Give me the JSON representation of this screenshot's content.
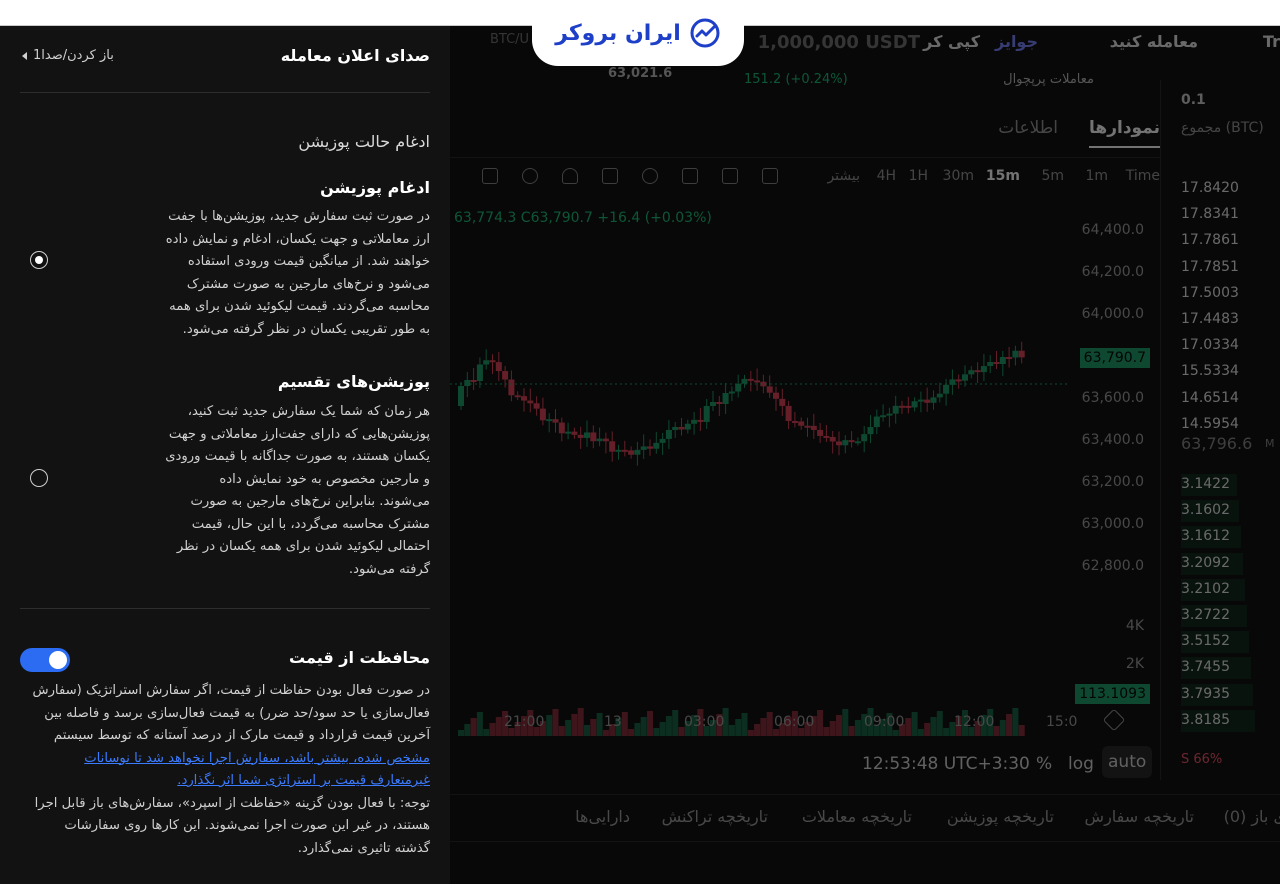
{
  "brand": {
    "logo_text": "ایران بروکر",
    "accent": "#1e3fc8"
  },
  "panel": {
    "title": "صدای اعلان معامله",
    "back_label": "باز کردن/صدا1",
    "section_heading": "ادغام حالت پوزیشن",
    "option_merge": {
      "title": "ادغام پوزیشن",
      "lines": [
        "در صورت ثبت سفارش جدید، پوزیشن‌ها با جفت",
        "ارز معاملاتی و جهت یکسان، ادغام و نمایش داده",
        "خواهند شد. از میانگین قیمت ورودی استفاده",
        "می‌شود و نرخ‌های مارجین به صورت مشترک",
        "محاسبه می‌گردند. قیمت لیکوئید شدن برای همه",
        "به طور تقریبی یکسان در نظر گرفته می‌شود."
      ],
      "selected": true
    },
    "option_split": {
      "title": "پوزیشن‌های تقسیم",
      "lines": [
        "هر زمان که شما یک سفارش جدید ثبت کنید،",
        "پوزیشن‌هایی که دارای جفت‌ارز معاملاتی و جهت",
        "یکسان هستند، به صورت جداگانه با قیمت ورودی",
        "و مارجین مخصوص به خود نمایش داده",
        "می‌شوند. بنابراین نرخ‌های مارجین به صورت",
        "مشترک محاسبه می‌گردد، با این حال، قیمت",
        "احتمالی لیکوئید شدن برای همه یکسان در نظر",
        "گرفته می‌شود."
      ],
      "selected": false
    },
    "price_protection": {
      "title": "محافظت از قیمت",
      "enabled": true,
      "toggle_color": "#2b6cf2",
      "lines": [
        "در صورت فعال بودن حفاظت از قیمت، اگر سفارش استراتژیک (سفارش",
        "فعال‌سازی یا حد سود/حد ضرر) به قیمت فعال‌سازی برسد و فاصله بین",
        "آخرین قیمت قرارداد و قیمت مارک از درصد آستانه که توسط سیستم"
      ],
      "link_lines": [
        "مشخص شده، بیشتر باشد، سفارش اجرا نخواهد شد تا نوسانات",
        "غیرمتعارف قیمت بر استراتژی شما اثر نگذارد."
      ],
      "note_lines": [
        "توجه: با فعال بودن گزینه «حفاظت از اسپرد»، سفارش‌های باز قابل اجرا",
        "هستند، در غیر این صورت اجرا نمی‌شوند. این کارها روی سفارشات",
        "گذشته تاثیری نمی‌گذارد."
      ]
    }
  },
  "background": {
    "nav": {
      "trade": "معامله کنید",
      "copy": "کپی کر",
      "prizes": "جوایز",
      "tr": "Tr",
      "balance": "1,000,000 USDT",
      "pair_search": "BTC/U"
    },
    "ticker": {
      "price_left": "63,021.6",
      "change": "151.2 (+0.24%)",
      "perp_label": "معاملات پرپچوال"
    },
    "tabs": [
      "نمودارها",
      "اطلاعات"
    ],
    "timeframes": [
      "Time",
      "1m",
      "5m",
      "15m",
      "30m",
      "1H",
      "4H",
      "بیشتر"
    ],
    "active_timeframe": "15m",
    "ohlc_text": "63,774.3 C63,790.7 +16.4 (+0.03%)",
    "y_ticks": [
      "64,400.0",
      "64,200.0",
      "64,000.0",
      "63,600.0",
      "63,400.0",
      "63,200.0",
      "63,000.0",
      "62,800.0"
    ],
    "last_price_tag": "63,790.7",
    "vol_ticks": [
      "4K",
      "2K"
    ],
    "vol_tag": "113.1093",
    "x_ticks": [
      "21:00",
      "13",
      "03:00",
      "06:00",
      "09:00",
      "12:00",
      "15:0"
    ],
    "clock": "12:53:48 UTC+3:30",
    "scale_buttons": [
      "%",
      "log",
      "auto"
    ],
    "history_tabs": [
      "ی باز (0)",
      "تاریخچه سفارش",
      "تاریخچه پوزیشن",
      "تاریخچه معاملات",
      "تاریخچه تراکنش",
      "دارایی‌ها"
    ],
    "orderbook": {
      "step": "0.1",
      "header": "مجموع (BTC)",
      "asks": [
        "17.8420",
        "17.8341",
        "17.7861",
        "17.7851",
        "17.5003",
        "17.4483",
        "17.0334",
        "15.5334",
        "14.6514",
        "14.5954"
      ],
      "mid": "63,796.6",
      "mid_badge": "M",
      "bids": [
        "3.1422",
        "3.1602",
        "3.1612",
        "3.2092",
        "3.2102",
        "3.2722",
        "3.5152",
        "3.7455",
        "3.7935",
        "3.8185"
      ],
      "sell_pct": "S 66%",
      "ask_color": "#f0566a",
      "bid_color": "#1fa06b"
    }
  }
}
